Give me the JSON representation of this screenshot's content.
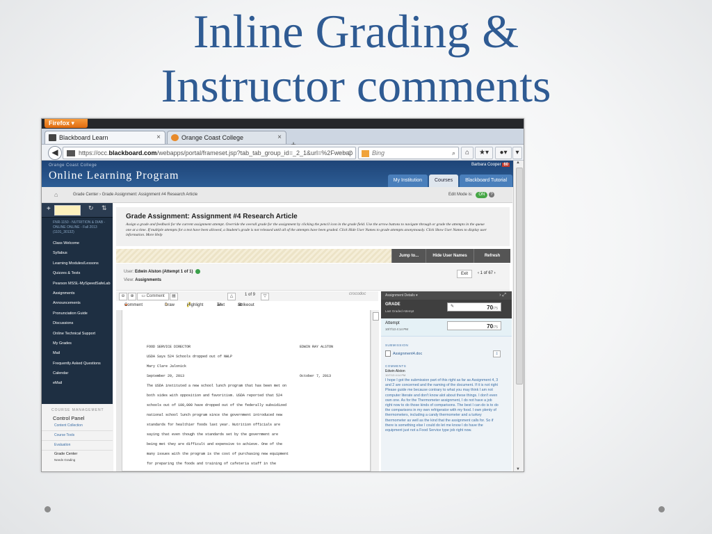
{
  "slide": {
    "title_line1": "Inline Grading &",
    "title_line2": "Instructor comments"
  },
  "browser": {
    "firefox_button": "Firefox ▾",
    "tabs": [
      {
        "label": "Blackboard Learn",
        "close": "×"
      },
      {
        "label": "Orange Coast College",
        "close": "×"
      }
    ],
    "new_tab": "+",
    "url_prefix": "https://occ.",
    "url_domain": "blackboard.com",
    "url_rest": "/webapps/portal/frameset.jsp?tab_tab_group_id=_2_1&url=%2Fwebap",
    "url_controls": "☆ ▿ C",
    "search_placeholder": "Bing",
    "search_icon": "⌕",
    "home_icon": "⌂",
    "bookmarks_icon": "★▾",
    "addon_icon": "●▾",
    "menu_icon": "▾"
  },
  "bb": {
    "institution_small": "Orange Coast College",
    "program_title": "Online Learning Program",
    "user_name": "Barbara Cooper",
    "user_badge": "60",
    "power_icon": "⏻",
    "top_tabs": [
      "My Institution",
      "Courses",
      "Blackboard Tutorial"
    ],
    "breadcrumb_home": "⌂",
    "breadcrumb": "Grade Center  ›  Grade Assignment: Assignment #4 Research Article",
    "edit_mode_label": "Edit Mode is:",
    "edit_mode_value": "ON",
    "help_icon": "?"
  },
  "course_menu": {
    "plus": "+",
    "course_name": "FNR-1150 - NUTRITION & DIAB - ONLINE ONLINE - Fall 2013 (1101_30132)",
    "items": [
      "Class Welcome",
      "Syllabus",
      "Learning Modules/Lessons",
      "Quizzes & Tests",
      "Pearson MSSL-MySpeedSafeLab",
      "Assignments",
      "Announcements",
      "Pronunciation Guide",
      "Discussions",
      "Online Technical Support",
      "My Grades",
      "Mail",
      "Frequently Asked Questions",
      "Calendar",
      "eMail"
    ],
    "management_header": "COURSE MANAGEMENT",
    "control_panel": "Control Panel",
    "panel_items": [
      "Content Collection",
      "Course Tools",
      "Evaluation"
    ],
    "grade_center": "Grade Center",
    "needs_grading": "Needs Grading"
  },
  "grade_assignment": {
    "title": "Grade Assignment: Assignment #4 Research Article",
    "description": "Assign a grade and feedback for the current assignment attempt. Override the overall grade for the assignment by clicking the pencil icon in the grade field. Use the arrow buttons to navigate through or grade the attempts in the queue one at a time. If multiple attempts for a test have been allowed, a Student's grade is not released until all of the attempts have been graded. Click Hide User Names to grade attempts anonymously. Click Show User Names to display user information. More Help",
    "buttons": [
      "Jump to...",
      "Hide User Names",
      "Refresh"
    ],
    "user_label": "User:",
    "user_value": "Edwin Alston (Attempt 1 of 1)",
    "view_label": "View:",
    "view_value": "Assignments",
    "exit": "Exit",
    "pager": "‹  1 of 67  ›"
  },
  "doc_viewer": {
    "zoom_out": "⊖",
    "zoom_in": "⊕",
    "comment_btn": "Comment",
    "page_count": "1 of 9",
    "powered_by": "crocodoc",
    "anno_tools": [
      "Comment ▾",
      "Draw",
      "Highlight",
      "Text",
      "Strikeout"
    ],
    "doc_lines": [
      {
        "l": "FOOD SERVICE DIRECTOR",
        "r": "EDWIN RAY ALSTON"
      },
      {
        "l": "USDA Says 524 Schools dropped out of NWLP",
        "r": ""
      },
      {
        "l": "Mary Clare Jalonick",
        "r": ""
      },
      {
        "l": "September 29, 2013",
        "r": "October 7, 2013"
      },
      {
        "l": "The USDA instituted a new school lunch program that has been met on",
        "r": ""
      },
      {
        "l": "both sides with opposition and favoritism. USDA reported that 524",
        "r": ""
      },
      {
        "l": "schools out of 100,000 have dropped out of the federally subsidized",
        "r": ""
      },
      {
        "l": "national school lunch program since the government introduced new",
        "r": ""
      },
      {
        "l": "standards for healthier foods last year.  Nutrition officials are",
        "r": ""
      },
      {
        "l": "saying that even though the standards set by the government are",
        "r": ""
      },
      {
        "l": "being met they are difficult and expensive to achieve. One of the",
        "r": ""
      },
      {
        "l": "many issues with the program is the cost of purchasing new equipment",
        "r": ""
      },
      {
        "l": "for preparing the foods and training of cafeteria staff in the",
        "r": ""
      }
    ]
  },
  "details": {
    "header": "Assignment Details ▾",
    "grade_label": "GRADE",
    "grade_sub": "Last Graded Attempt",
    "grade_value": "70",
    "grade_max": "/75",
    "attempt_label": "Attempt",
    "attempt_date": "10/7/13 4:14 PM",
    "attempt_value": "70",
    "attempt_max": "/75",
    "submission_header": "SUBMISSION",
    "file_name": "Assignment4.doc",
    "comments_header": "COMMENTS",
    "comment_author": "Edwin Alston",
    "comment_date": "10/7/13 4:14 PM",
    "comment_text": "I hope I got the submission part of this right as far as Assignment 4, 3 and 2 are concerned and the naming of the document. If it is not right Please guide me because contrary to what you may think I am not computer literate and don't know alot about these things. I don't even own one. As for the Thermometer assignment, I do not have a job right now to do those kinds of comparisons. The best I can do is to do the comparisons in my own refrigerator with my food. I own plenty of thermometers, including a candy thermometer and a turkey thermometer as well as the kind that the assignment calls for. So if there is something else I could do let me know I do have the equipment just not a Food Service type job right now."
  }
}
